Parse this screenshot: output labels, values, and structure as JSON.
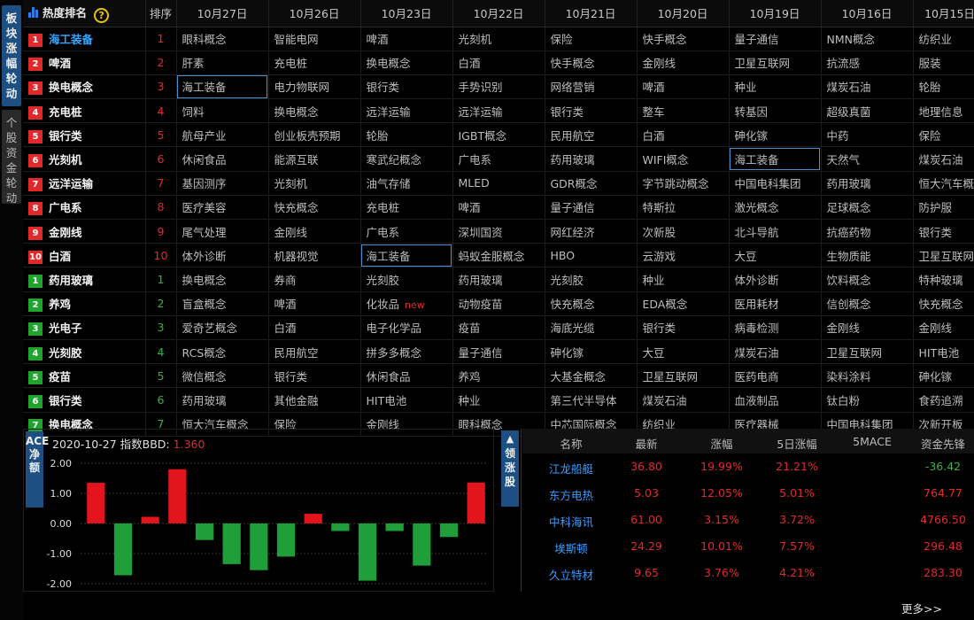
{
  "side_tabs": [
    {
      "label": "板块涨幅轮动",
      "active": true
    },
    {
      "label": "个股资金轮动",
      "active": false
    }
  ],
  "ranking": {
    "header": {
      "hot_label": "热度排名",
      "help_icon": "?",
      "rank_label": "排序",
      "dates": [
        "10月27日",
        "10月26日",
        "10月23日",
        "10月22日",
        "10月21日",
        "10月20日",
        "10月19日",
        "10月16日",
        "10月15日"
      ]
    },
    "rows": [
      {
        "badge": "1",
        "name": "海工装备",
        "rank": "1",
        "dir": "up",
        "cells": [
          "眼科概念",
          "智能电网",
          "啤酒",
          "光刻机",
          "保险",
          "快手概念",
          "量子通信",
          "NMN概念",
          "纺织业"
        ]
      },
      {
        "badge": "2",
        "name": "啤酒",
        "rank": "2",
        "dir": "up",
        "cells": [
          "肝素",
          "充电桩",
          "换电概念",
          "白酒",
          "快手概念",
          "金刚线",
          "卫星互联网",
          "抗流感",
          "服装"
        ]
      },
      {
        "badge": "3",
        "name": "换电概念",
        "rank": "3",
        "dir": "up",
        "cells": [
          "海工装备",
          "电力物联网",
          "银行类",
          "手势识别",
          "网络营销",
          "啤酒",
          "种业",
          "煤炭石油",
          "轮胎"
        ]
      },
      {
        "badge": "4",
        "name": "充电桩",
        "rank": "4",
        "dir": "up",
        "cells": [
          "饲料",
          "换电概念",
          "远洋运输",
          "远洋运输",
          "银行类",
          "整车",
          "转基因",
          "超级真菌",
          "地理信息"
        ]
      },
      {
        "badge": "5",
        "name": "银行类",
        "rank": "5",
        "dir": "up",
        "cells": [
          "航母产业",
          "创业板壳预期",
          "轮胎",
          "IGBT概念",
          "民用航空",
          "白酒",
          "砷化镓",
          "中药",
          "保险"
        ]
      },
      {
        "badge": "6",
        "name": "光刻机",
        "rank": "6",
        "dir": "up",
        "cells": [
          "休闲食品",
          "能源互联",
          "寒武纪概念",
          "广电系",
          "药用玻璃",
          "WIFI概念",
          "海工装备",
          "天然气",
          "煤炭石油"
        ]
      },
      {
        "badge": "7",
        "name": "远洋运输",
        "rank": "7",
        "dir": "up",
        "cells": [
          "基因测序",
          "光刻机",
          "油气存储",
          "MLED",
          "GDR概念",
          "字节跳动概念",
          "中国电科集团",
          "药用玻璃",
          "恒大汽车概"
        ]
      },
      {
        "badge": "8",
        "name": "广电系",
        "rank": "8",
        "dir": "up",
        "cells": [
          "医疗美容",
          "快充概念",
          "充电桩",
          "啤酒",
          "量子通信",
          "特斯拉",
          "激光概念",
          "足球概念",
          "防护服"
        ]
      },
      {
        "badge": "9",
        "name": "金刚线",
        "rank": "9",
        "dir": "up",
        "cells": [
          "尾气处理",
          "金刚线",
          "广电系",
          "深圳国资",
          "网红经济",
          "次新股",
          "北斗导航",
          "抗癌药物",
          "银行类"
        ]
      },
      {
        "badge": "10",
        "name": "白酒",
        "rank": "10",
        "dir": "up",
        "cells": [
          "体外诊断",
          "机器视觉",
          "海工装备",
          "蚂蚁金服概念",
          "HBO",
          "云游戏",
          "大豆",
          "生物质能",
          "卫星互联网"
        ]
      },
      {
        "badge": "1",
        "name": "药用玻璃",
        "rank": "1",
        "dir": "dn",
        "cells": [
          "换电概念",
          "券商",
          "光刻胶",
          "药用玻璃",
          "光刻胶",
          "种业",
          "体外诊断",
          "饮料概念",
          "特种玻璃"
        ]
      },
      {
        "badge": "2",
        "name": "养鸡",
        "rank": "2",
        "dir": "dn",
        "cells": [
          "盲盒概念",
          "啤酒",
          "化妆品",
          "动物疫苗",
          "快充概念",
          "EDA概念",
          "医用耗材",
          "信创概念",
          "快充概念"
        ]
      },
      {
        "badge": "3",
        "name": "光电子",
        "rank": "3",
        "dir": "dn",
        "cells": [
          "爱奇艺概念",
          "白酒",
          "电子化学品",
          "疫苗",
          "海底光缆",
          "银行类",
          "病毒检测",
          "金刚线",
          "金刚线"
        ]
      },
      {
        "badge": "4",
        "name": "光刻胶",
        "rank": "4",
        "dir": "dn",
        "cells": [
          "RCS概念",
          "民用航空",
          "拼多多概念",
          "量子通信",
          "砷化镓",
          "大豆",
          "煤炭石油",
          "卫星互联网",
          "HIT电池"
        ]
      },
      {
        "badge": "5",
        "name": "疫苗",
        "rank": "5",
        "dir": "dn",
        "cells": [
          "微信概念",
          "银行类",
          "休闲食品",
          "养鸡",
          "大基金概念",
          "卫星互联网",
          "医药电商",
          "染料涂料",
          "砷化镓"
        ]
      },
      {
        "badge": "6",
        "name": "银行类",
        "rank": "6",
        "dir": "dn",
        "cells": [
          "药用玻璃",
          "其他金融",
          "HIT电池",
          "种业",
          "第三代半导体",
          "煤炭石油",
          "血液制品",
          "钛白粉",
          "食药追溯"
        ]
      },
      {
        "badge": "7",
        "name": "换电概念",
        "rank": "7",
        "dir": "dn",
        "cells": [
          "恒大汽车概念",
          "保险",
          "金刚线",
          "眼科概念",
          "中芯国际概念",
          "纺织业",
          "医疗器械",
          "中国电科集团",
          "次新开板"
        ]
      }
    ],
    "new_tag": "new"
  },
  "ace": {
    "tab_label": "ACE净额",
    "date": "2020-10-27",
    "index_label": "指数BBD:",
    "index_value": "1.360",
    "chart_data": {
      "type": "bar",
      "title": "",
      "ylim": [
        -2.0,
        2.0
      ],
      "yticks": [
        "2.00",
        "1.00",
        "0.00",
        "-1.00",
        "-2.00"
      ],
      "values": [
        1.35,
        -1.72,
        0.22,
        1.8,
        -0.55,
        -1.35,
        -1.55,
        -1.1,
        0.32,
        -0.25,
        -1.9,
        -0.25,
        -1.4,
        -0.45,
        1.36
      ],
      "colors": {
        "positive": "#e3141b",
        "negative": "#1f9e3a"
      },
      "grid": true
    }
  },
  "lead": {
    "tab_label": "领涨股",
    "columns": [
      "名称",
      "最新",
      "涨幅",
      "5日涨幅",
      "5MACE",
      "资金先锋"
    ],
    "rows": [
      {
        "name": "江龙船艇",
        "price": "36.80",
        "change": "19.99%",
        "change5": "21.21%",
        "mace": "",
        "fund": "-36.42",
        "fund_dir": "g"
      },
      {
        "name": "东方电热",
        "price": "5.03",
        "change": "12.05%",
        "change5": "5.01%",
        "mace": "",
        "fund": "764.77",
        "fund_dir": "r"
      },
      {
        "name": "中科海讯",
        "price": "61.00",
        "change": "3.15%",
        "change5": "3.72%",
        "mace": "",
        "fund": "4766.50",
        "fund_dir": "r"
      },
      {
        "name": "埃斯顿",
        "price": "24.29",
        "change": "10.01%",
        "change5": "7.57%",
        "mace": "",
        "fund": "296.48",
        "fund_dir": "r"
      },
      {
        "name": "久立特材",
        "price": "9.65",
        "change": "3.76%",
        "change5": "4.21%",
        "mace": "",
        "fund": "283.30",
        "fund_dir": "r"
      }
    ],
    "more_label": "更多>>"
  }
}
